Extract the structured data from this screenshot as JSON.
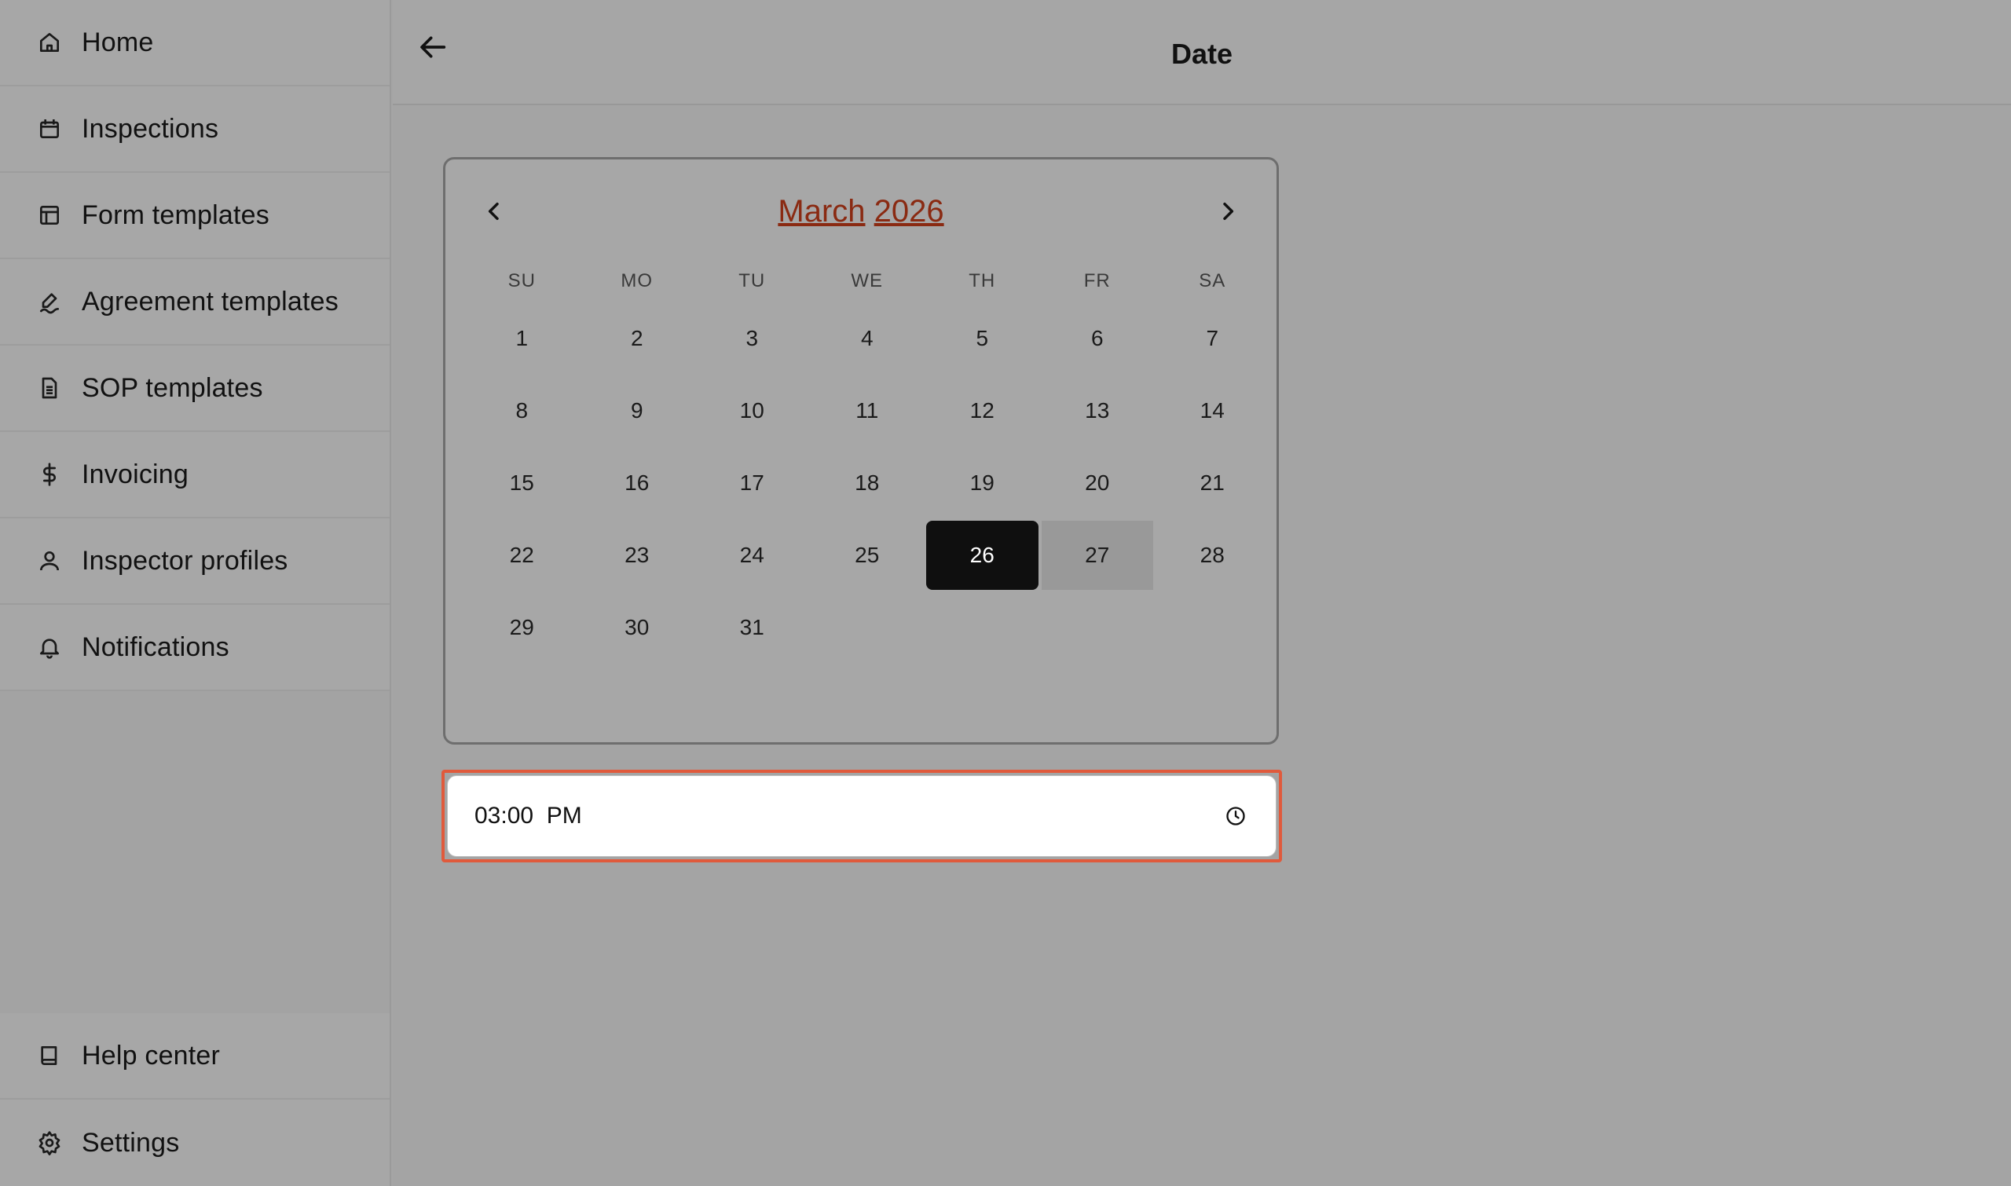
{
  "sidebar": {
    "items": [
      {
        "label": "Home",
        "icon": "home-icon"
      },
      {
        "label": "Inspections",
        "icon": "calendar-icon"
      },
      {
        "label": "Form templates",
        "icon": "layout-icon"
      },
      {
        "label": "Agreement templates",
        "icon": "signature-icon"
      },
      {
        "label": "SOP templates",
        "icon": "document-icon"
      },
      {
        "label": "Invoicing",
        "icon": "dollar-icon"
      },
      {
        "label": "Inspector profiles",
        "icon": "user-icon"
      },
      {
        "label": "Notifications",
        "icon": "bell-icon"
      }
    ],
    "bottom_items": [
      {
        "label": "Help center",
        "icon": "book-icon"
      },
      {
        "label": "Settings",
        "icon": "gear-icon"
      }
    ]
  },
  "header": {
    "title": "Date"
  },
  "calendar": {
    "month": "March",
    "year": "2026",
    "weekdays": [
      "SU",
      "MO",
      "TU",
      "WE",
      "TH",
      "FR",
      "SA"
    ],
    "days": [
      "1",
      "2",
      "3",
      "4",
      "5",
      "6",
      "7",
      "8",
      "9",
      "10",
      "11",
      "12",
      "13",
      "14",
      "15",
      "16",
      "17",
      "18",
      "19",
      "20",
      "21",
      "22",
      "23",
      "24",
      "25",
      "26",
      "27",
      "28",
      "29",
      "30",
      "31"
    ],
    "first_weekday_index": 0,
    "selected_day": "26",
    "hovered_day": "27",
    "caption_color": "#8a2a12"
  },
  "time_input": {
    "value": "03:00  PM",
    "focus_color": "#e05a3c"
  }
}
